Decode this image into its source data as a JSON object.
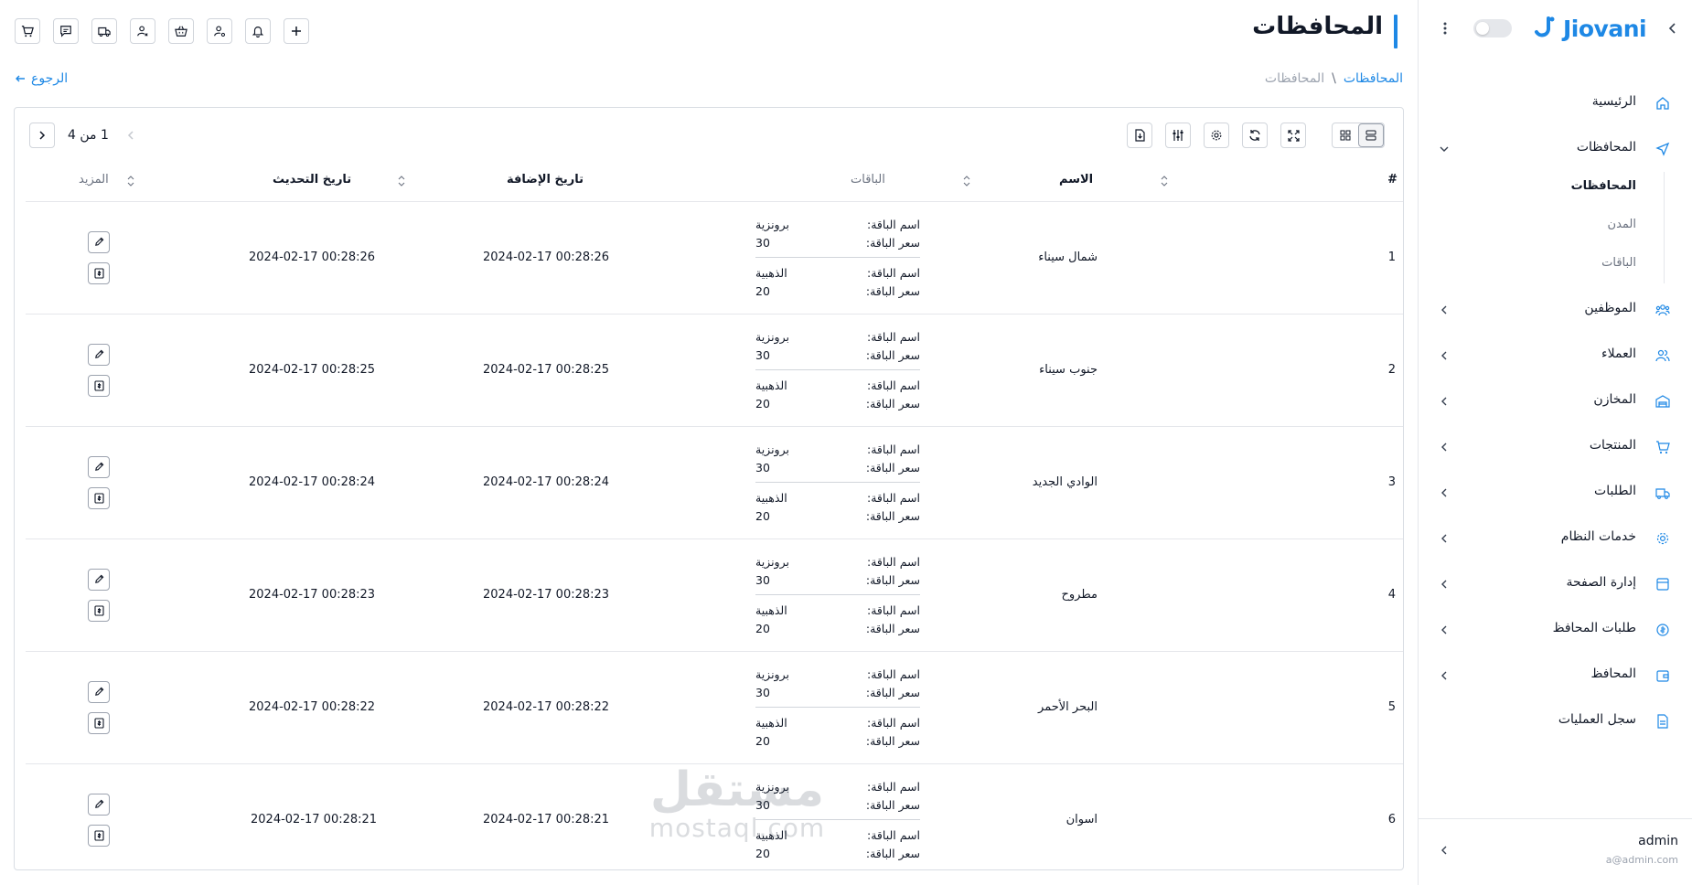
{
  "brand": {
    "name": "Jiovani",
    "accent": "#1e88e5"
  },
  "page": {
    "title": "المحافظات"
  },
  "breadcrumb": {
    "root": "المحافظات",
    "separator": "\\",
    "current": "المحافظات"
  },
  "back": {
    "label": "الرجوع"
  },
  "sidebar": {
    "items": [
      {
        "label": "الرئيسية",
        "icon": "home-icon"
      },
      {
        "label": "المحافظات",
        "icon": "send-icon",
        "expanded": true,
        "children": [
          {
            "label": "المحافظات",
            "active": true
          },
          {
            "label": "المدن"
          },
          {
            "label": "الباقات"
          }
        ]
      },
      {
        "label": "الموظفين",
        "icon": "team-icon"
      },
      {
        "label": "العملاء",
        "icon": "users-icon"
      },
      {
        "label": "المخازن",
        "icon": "warehouse-icon"
      },
      {
        "label": "المنتجات",
        "icon": "cart-icon"
      },
      {
        "label": "الطلبات",
        "icon": "truck-icon"
      },
      {
        "label": "خدمات النظام",
        "icon": "gear-icon"
      },
      {
        "label": "إدارة الصفحة",
        "icon": "page-icon"
      },
      {
        "label": "طلبات المحافظ",
        "icon": "coin-icon"
      },
      {
        "label": "المحافظ",
        "icon": "wallet-icon"
      },
      {
        "label": "سجل العمليات",
        "icon": "log-icon"
      }
    ],
    "user": {
      "name": "admin",
      "email": "a@admin.com"
    }
  },
  "toolbar_icons": [
    "cart-icon",
    "chat-icon",
    "truck-icon",
    "user-cross-icon",
    "basket-icon",
    "user-gear-icon",
    "bell-icon",
    "plus-icon"
  ],
  "pagination": {
    "text": "1 من 4"
  },
  "table": {
    "headers": {
      "num": "#",
      "name": "الاسم",
      "packages": "الباقات",
      "added": "تاريخ الإضافة",
      "updated": "تاريخ التحديث",
      "more": "المزيد"
    },
    "pkg_name_label": "اسم الباقة:",
    "pkg_price_label": "سعر الباقة:",
    "rows": [
      {
        "num": "1",
        "name": "شمال سيناء",
        "added": "2024-02-17 00:28:26",
        "updated": "2024-02-17 00:28:26",
        "packages": [
          {
            "name": "برونزية",
            "price": "30"
          },
          {
            "name": "الذهبية",
            "price": "20"
          }
        ]
      },
      {
        "num": "2",
        "name": "جنوب سيناء",
        "added": "2024-02-17 00:28:25",
        "updated": "2024-02-17 00:28:25",
        "packages": [
          {
            "name": "برونزية",
            "price": "30"
          },
          {
            "name": "الذهبية",
            "price": "20"
          }
        ]
      },
      {
        "num": "3",
        "name": "الوادي الجديد",
        "added": "2024-02-17 00:28:24",
        "updated": "2024-02-17 00:28:24",
        "packages": [
          {
            "name": "برونزية",
            "price": "30"
          },
          {
            "name": "الذهبية",
            "price": "20"
          }
        ]
      },
      {
        "num": "4",
        "name": "مطروح",
        "added": "2024-02-17 00:28:23",
        "updated": "2024-02-17 00:28:23",
        "packages": [
          {
            "name": "برونزية",
            "price": "30"
          },
          {
            "name": "الذهبية",
            "price": "20"
          }
        ]
      },
      {
        "num": "5",
        "name": "البحر الأحمر",
        "added": "2024-02-17 00:28:22",
        "updated": "2024-02-17 00:28:22",
        "packages": [
          {
            "name": "برونزية",
            "price": "30"
          },
          {
            "name": "الذهبية",
            "price": "20"
          }
        ]
      },
      {
        "num": "6",
        "name": "اسوان",
        "added": "2024-02-17 00:28:21",
        "updated": "2024-02-17 00:28:21",
        "packages": [
          {
            "name": "برونزية",
            "price": "30"
          },
          {
            "name": "الذهبية",
            "price": "20"
          }
        ]
      }
    ]
  },
  "watermark": {
    "arabic": "مستقل",
    "latin": "mostaql.com"
  }
}
